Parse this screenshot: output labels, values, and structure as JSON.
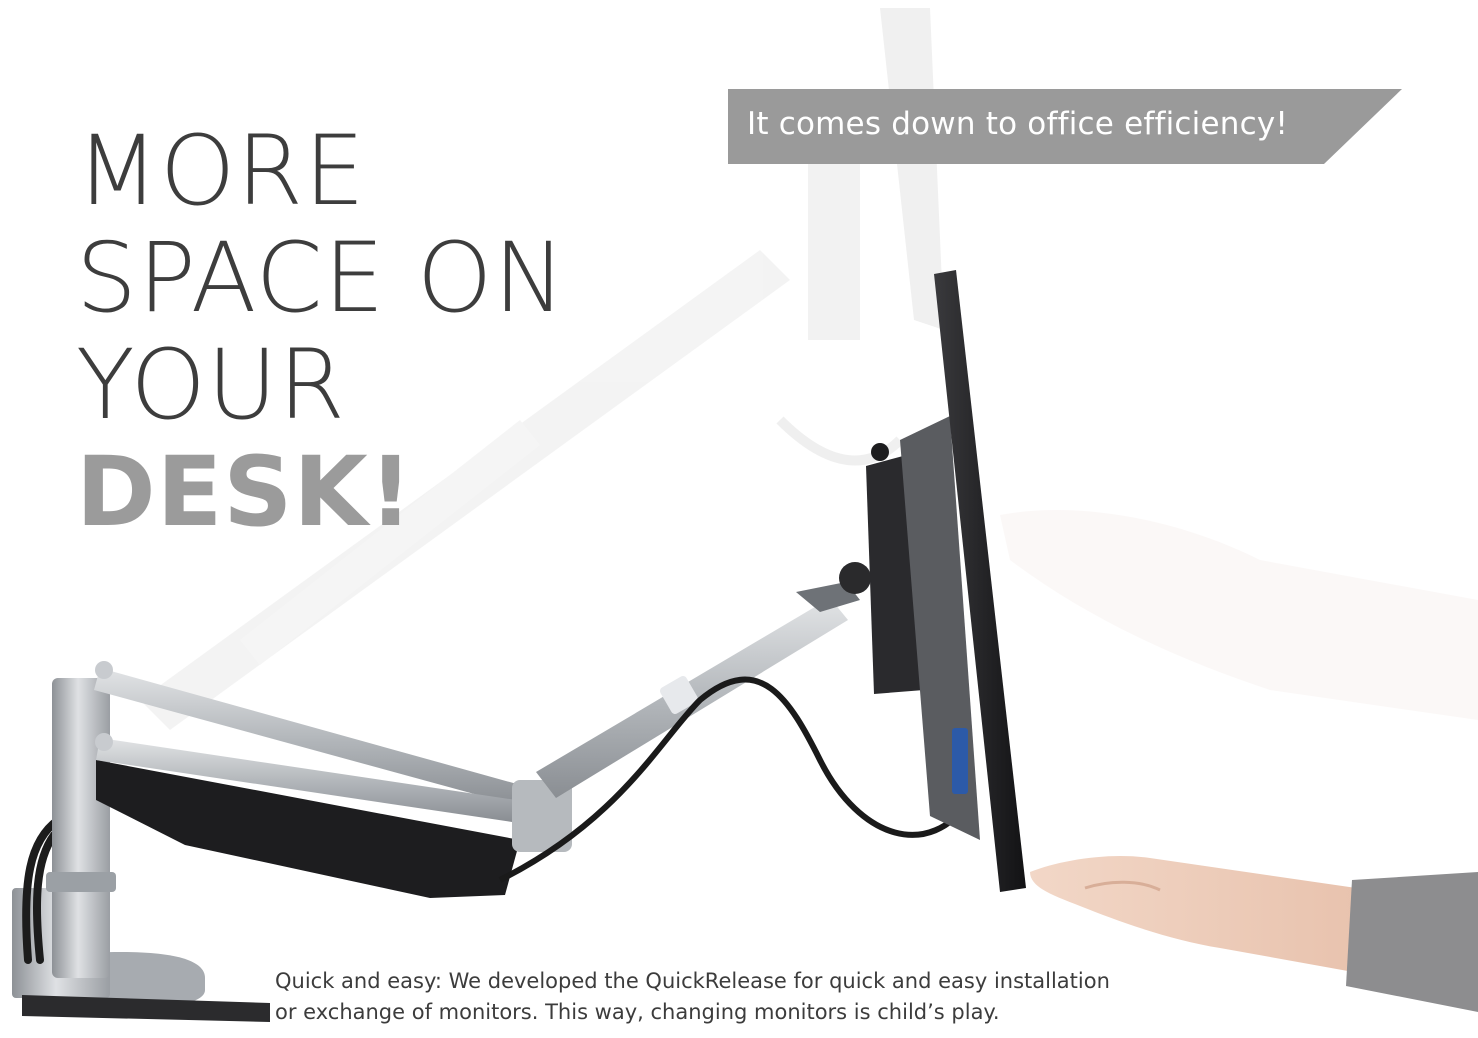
{
  "headline": {
    "line1": "MORE",
    "line2": "SPACE ON",
    "line3": "YOUR",
    "line4": "DESK!"
  },
  "banner": {
    "text": "It comes down to office efficiency!",
    "color": "#9a9a9a"
  },
  "caption": {
    "line1": "Quick and easy: We developed the QuickRelease for quick and easy installation",
    "line2": "or exchange of monitors. This way, changing monitors is child’s play."
  },
  "colors": {
    "headline": "#3d3d3d",
    "headline_accent": "#9b9b9b",
    "arm_silver": "#b9bcc0",
    "monitor_black": "#1d1d1f",
    "connector_blue": "#2c5aa8"
  }
}
